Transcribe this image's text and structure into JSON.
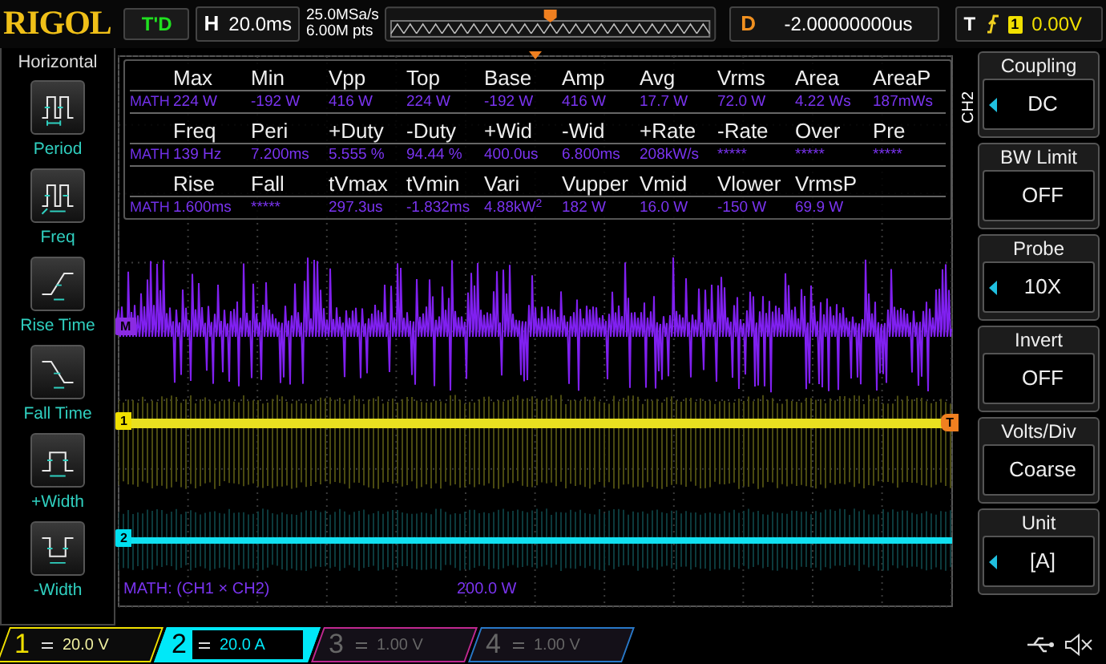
{
  "logo": "RIGOL",
  "trigger_status": "T'D",
  "timebase": {
    "label": "H",
    "value": "20.0ms"
  },
  "acquisition": {
    "sample_rate": "25.0MSa/s",
    "memory_depth": "6.00M pts"
  },
  "delay": {
    "label": "D",
    "value": "-2.00000000us"
  },
  "trigger": {
    "label": "T",
    "source": "1",
    "value": "0.00V"
  },
  "left_menu": {
    "title": "Horizontal",
    "items": [
      {
        "label": "Period",
        "kind": "period"
      },
      {
        "label": "Freq",
        "kind": "freq"
      },
      {
        "label": "Rise Time",
        "kind": "rise"
      },
      {
        "label": "Fall Time",
        "kind": "fall"
      },
      {
        "label": "+Width",
        "kind": "pwidth"
      },
      {
        "label": "-Width",
        "kind": "nwidth"
      }
    ]
  },
  "measurements": {
    "rows": [
      {
        "headers": [
          "Max",
          "Min",
          "Vpp",
          "Top",
          "Base",
          "Amp",
          "Avg",
          "Vrms",
          "Area",
          "AreaP"
        ],
        "source": "MATH",
        "values": [
          "224 W",
          "-192 W",
          "416 W",
          "224 W",
          "-192 W",
          "416 W",
          "17.7 W",
          "72.0 W",
          "4.22 Ws",
          "187mWs"
        ]
      },
      {
        "headers": [
          "Freq",
          "Peri",
          "+Duty",
          "-Duty",
          "+Wid",
          "-Wid",
          "+Rate",
          "-Rate",
          "Over",
          "Pre"
        ],
        "source": "MATH",
        "values": [
          "139 Hz",
          "7.200ms",
          "5.555 %",
          "94.44 %",
          "400.0us",
          "6.800ms",
          "208kW/s",
          "*****",
          "*****",
          "*****"
        ]
      },
      {
        "headers": [
          "Rise",
          "Fall",
          "tVmax",
          "tVmin",
          "Vari",
          "Vupper",
          "Vmid",
          "Vlower",
          "VrmsP"
        ],
        "source": "MATH",
        "values": [
          "1.600ms",
          "*****",
          "297.3us",
          "-1.832ms",
          {
            "text": "4.88kW",
            "superscript": "2"
          },
          "182 W",
          "16.0 W",
          "-150 W",
          "69.9 W"
        ]
      }
    ]
  },
  "markers": [
    {
      "text": "M",
      "color": "#8a2be2"
    },
    {
      "text": "1",
      "color": "#f0e000"
    },
    {
      "text": "2",
      "color": "#00e0f0"
    }
  ],
  "trigger_marker": "T",
  "math_info": {
    "expression": "MATH: (CH1 × CH2)",
    "scale": "200.0 W"
  },
  "right_menu": {
    "channel": "CH2",
    "items": [
      {
        "title": "Coupling",
        "value": "DC",
        "adjustable": true
      },
      {
        "title": "BW Limit",
        "value": "OFF",
        "adjustable": false
      },
      {
        "title": "Probe",
        "value": "10X",
        "adjustable": true
      },
      {
        "title": "Invert",
        "value": "OFF",
        "adjustable": false
      },
      {
        "title": "Volts/Div",
        "value": "Coarse",
        "adjustable": false
      },
      {
        "title": "Unit",
        "value": "[A]",
        "adjustable": true
      }
    ]
  },
  "channels": [
    {
      "number": "1",
      "scale": "20.0 V",
      "on": true,
      "selected": false,
      "color": "#f0e000"
    },
    {
      "number": "2",
      "scale": "20.0 A",
      "on": true,
      "selected": true,
      "color": "#00e8f8"
    },
    {
      "number": "3",
      "scale": "1.00 V",
      "on": false,
      "selected": false,
      "color": "#c02890"
    },
    {
      "number": "4",
      "scale": "1.00 V",
      "on": false,
      "selected": false,
      "color": "#2878c8"
    }
  ]
}
